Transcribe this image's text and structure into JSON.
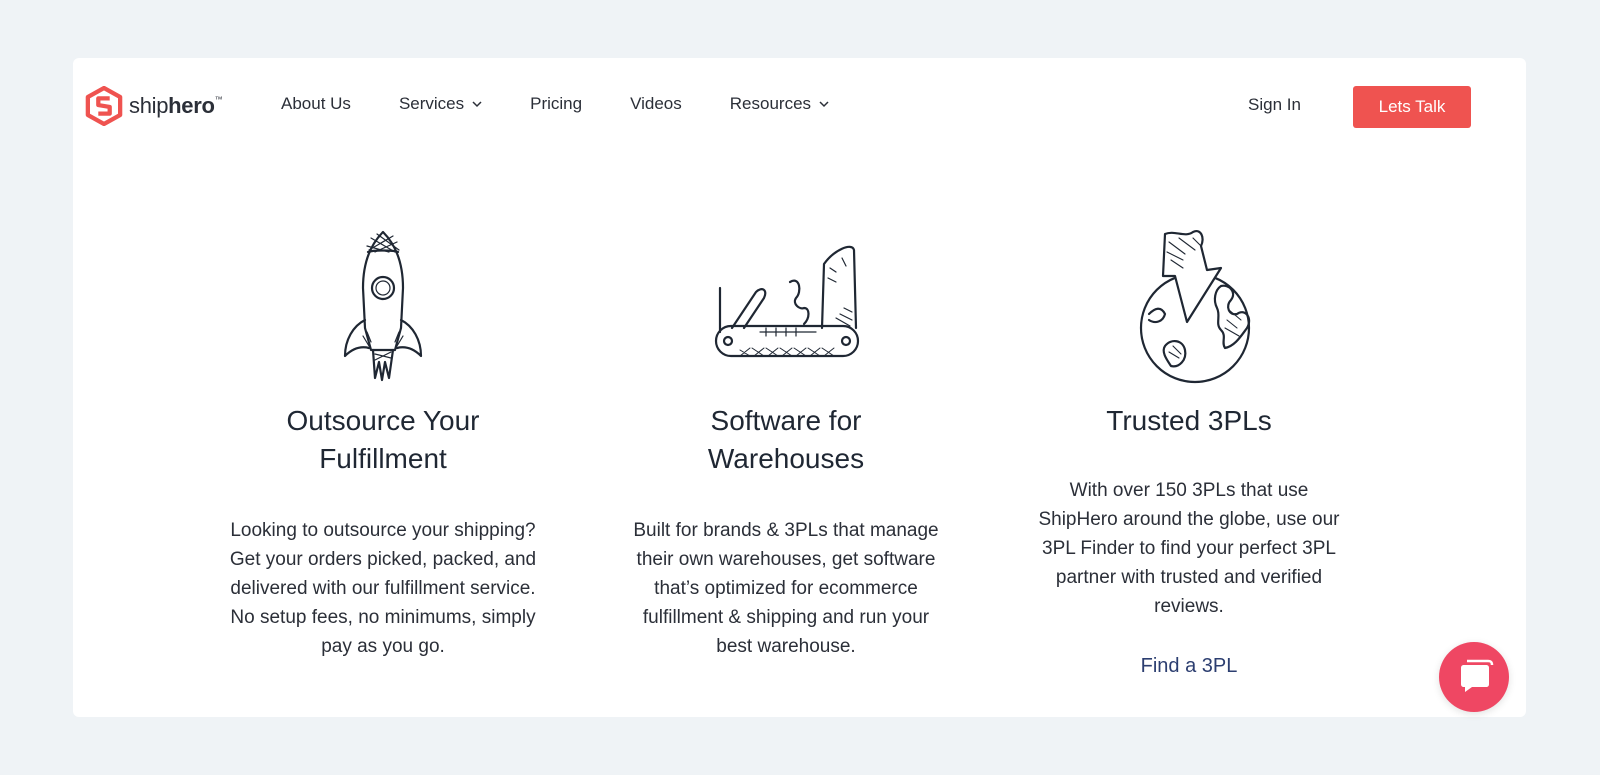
{
  "brand": {
    "name_light": "ship",
    "name_bold": "hero",
    "trademark": "™",
    "accent_color": "#ef5350"
  },
  "nav": {
    "items": [
      {
        "label": "About Us",
        "has_dropdown": false
      },
      {
        "label": "Services",
        "has_dropdown": true
      },
      {
        "label": "Pricing",
        "has_dropdown": false
      },
      {
        "label": "Videos",
        "has_dropdown": false
      },
      {
        "label": "Resources",
        "has_dropdown": true
      }
    ],
    "sign_in": "Sign In",
    "cta": "Lets Talk"
  },
  "features": [
    {
      "icon": "rocket-icon",
      "title": "Outsource Your Fulfillment",
      "body": "Looking to outsource your shipping? Get your orders picked, packed, and delivered with our fulfillment service. No setup fees, no minimums, simply pay as you go."
    },
    {
      "icon": "pocket-knife-icon",
      "title": "Software for Warehouses",
      "body": "Built for brands & 3PLs that manage their own warehouses, get software that’s optimized for ecommerce fulfillment & shipping and run your best warehouse."
    },
    {
      "icon": "globe-pin-icon",
      "title": "Trusted 3PLs",
      "body": "With over 150 3PLs that use ShipHero around the globe, use our 3PL Finder to find your perfect 3PL partner with trusted and verified reviews.",
      "link": "Find a 3PL"
    }
  ],
  "chat": {
    "icon": "chat-bubble-icon",
    "color": "#ef4763"
  }
}
